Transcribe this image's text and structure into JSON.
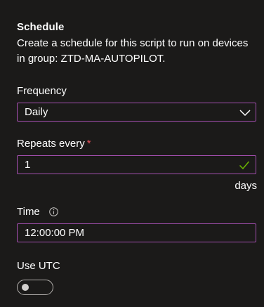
{
  "section": {
    "title": "Schedule",
    "description": "Create a schedule for this script to run on devices in group: ZTD-MA-AUTOPILOT."
  },
  "frequency": {
    "label": "Frequency",
    "value": "Daily",
    "icon": "chevron-down-icon"
  },
  "repeats": {
    "label": "Repeats every",
    "required_marker": "*",
    "value": "1",
    "unit": "days",
    "valid_icon": "checkmark-icon"
  },
  "time": {
    "label": "Time",
    "info_icon": "info-icon",
    "value": "12:00:00 PM"
  },
  "utc": {
    "label": "Use UTC",
    "enabled": false
  },
  "colors": {
    "background": "#1b1a19",
    "field_border": "#a44fb0",
    "required": "#e6505a",
    "valid_check": "#6bb700"
  }
}
